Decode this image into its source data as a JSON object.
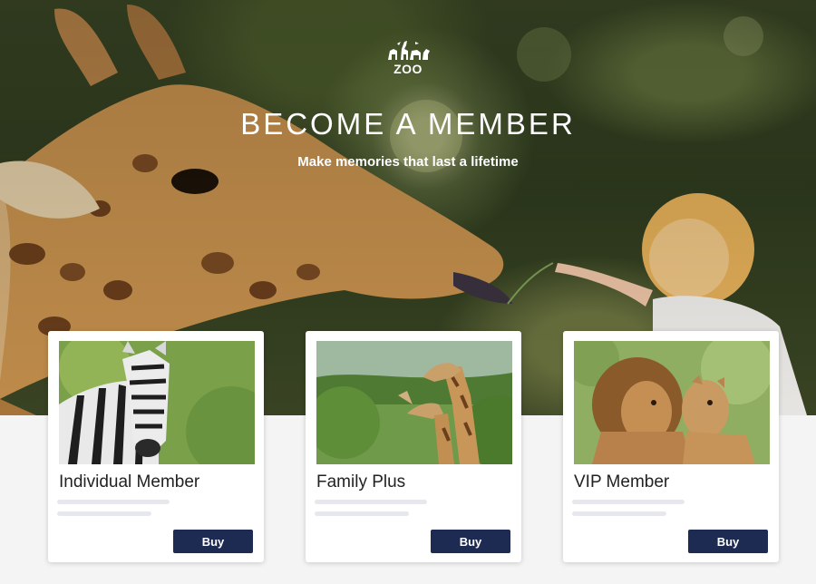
{
  "brand": {
    "logo_text": "ZOO",
    "logo_icon": "animals-silhouette-icon"
  },
  "hero": {
    "title": "BECOME A MEMBER",
    "subtitle": "Make memories that last a lifetime"
  },
  "plans": [
    {
      "name": "Individual Member",
      "button": "Buy",
      "image": "zebra-photo"
    },
    {
      "name": "Family Plus",
      "button": "Buy",
      "image": "giraffes-photo"
    },
    {
      "name": "VIP Member",
      "button": "Buy",
      "image": "lions-photo"
    }
  ],
  "colors": {
    "button": "#1d2b53",
    "page_background": "#f4f4f4",
    "card": "#ffffff"
  }
}
